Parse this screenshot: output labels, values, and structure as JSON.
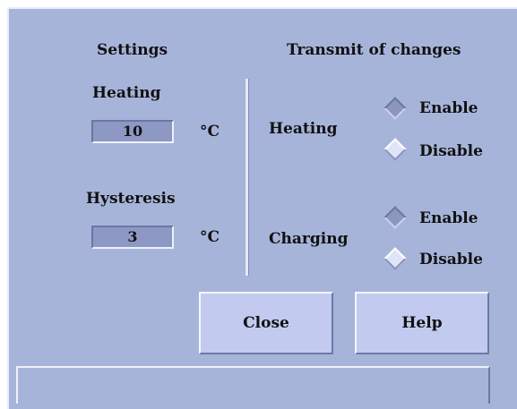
{
  "settings": {
    "title": "Settings",
    "heating_label": "Heating",
    "heating_value": "10",
    "hysteresis_label": "Hysteresis",
    "hysteresis_value": "3",
    "unit": "°C"
  },
  "transmit": {
    "title": "Transmit of changes",
    "heating_label": "Heating",
    "charging_label": "Charging",
    "enable_label": "Enable",
    "disable_label": "Disable",
    "heating_selected": "Enable",
    "charging_selected": "Enable"
  },
  "buttons": {
    "close_label": "Close",
    "help_label": "Help"
  },
  "status": {
    "text": ""
  }
}
